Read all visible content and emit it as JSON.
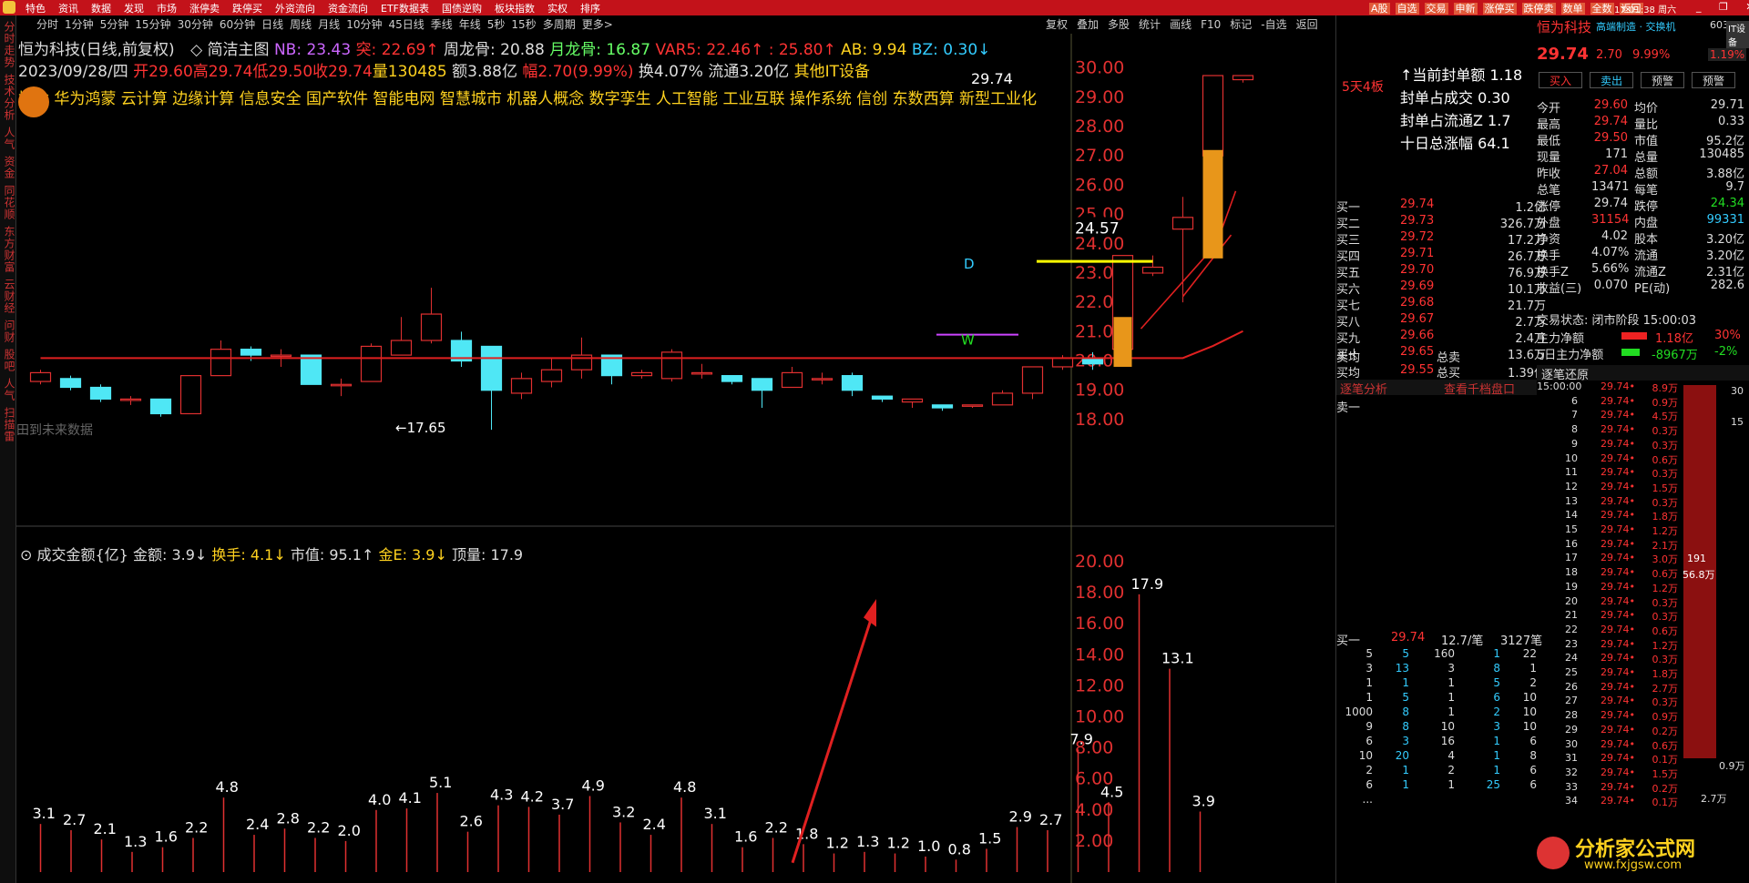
{
  "topbar": {
    "menu": [
      "特色",
      "资讯",
      "数据",
      "发现",
      "市场",
      "涨停卖",
      "跌停买",
      "外资流向",
      "资金流向",
      "ETF数据表",
      "国债逆购",
      "板块指数",
      "实权",
      "排序"
    ],
    "right": [
      "A股",
      "自选",
      "交易",
      "申新",
      "涨停买",
      "跌停卖",
      "数单",
      "全数",
      "返回"
    ],
    "clock": "17:01:38 周六",
    "winbtns": "_ ❐ ✕"
  },
  "periods": [
    "分时",
    "1分钟",
    "5分钟",
    "15分钟",
    "30分钟",
    "60分钟",
    "日线",
    "周线",
    "月线",
    "10分钟",
    "45日线",
    "季线",
    "年线",
    "5秒",
    "15秒",
    "多周期",
    "更多>"
  ],
  "rtools": [
    "复权",
    "叠加",
    "多股",
    "统计",
    "画线",
    "F10",
    "标记",
    "-自选",
    "返回"
  ],
  "leftstrip": [
    "分时走势",
    "技术分析",
    "人气",
    "资金",
    "同花顺",
    "东方财富",
    "云财经",
    "问财",
    "股吧",
    "人气",
    "扫描雷"
  ],
  "stock": {
    "name": "恒为科技(日线,前复权)",
    "indicator_main": "简洁主图",
    "nb": "NB: 23.43",
    "tu": "突: 22.69↑",
    "zhoulonggu": "周龙骨: 20.88",
    "yuelonggu": "月龙骨: 16.87",
    "var5": "VAR5: 22.46↑",
    "v2": ": 25.80↑",
    "ab": "AB: 9.94",
    "bz": "BZ: 0.30↓"
  },
  "quote_line": {
    "date": "2023/09/28/四",
    "open": "开29.60",
    "high": "高29.74",
    "low": "低29.50",
    "close": "收29.74",
    "vol": "量130485",
    "amt": "额3.88亿",
    "range": "幅2.70(9.99%)",
    "turn": "换4.07%",
    "float": "流通3.20亿",
    "industry": "其他IT设备"
  },
  "concepts": "概念 华为鸿蒙 云计算 边缘计算 信息安全 国产软件 智能电网 智慧城市 机器人概念 数字孪生 人工智能 工业互联 操作系统 信创 东数西算 新型工业化",
  "price_label": "29.74",
  "low_label": "17.65",
  "future_label": "田到未来数据",
  "marker_D": "D",
  "marker_W": "W",
  "cur_price_tag": "24.57",
  "vol_header": {
    "title": "成交金额{亿}",
    "je": "金额: 3.9↓",
    "hs": "换手: 4.1↓",
    "sz": "市值: 95.1↑",
    "jine": "金E: 3.9↓",
    "dl": "顶量: 17.9"
  },
  "price_axis": [
    "30.00",
    "29.00",
    "28.00",
    "27.00",
    "26.00",
    "25.00",
    "24.00",
    "23.00",
    "22.00",
    "21.00",
    "20.00",
    "19.00",
    "18.00"
  ],
  "vol_axis": [
    "20.00",
    "18.00",
    "16.00",
    "14.00",
    "12.00",
    "10.00",
    "8.00",
    "6.00",
    "4.00",
    "2.00"
  ],
  "chart_data": {
    "type": "candlestick+bar",
    "candles": [
      [
        19.3,
        19.6,
        19.2,
        19.7
      ],
      [
        19.4,
        19.1,
        19.0,
        19.5
      ],
      [
        19.1,
        18.7,
        18.6,
        19.2
      ],
      [
        18.7,
        18.7,
        18.5,
        18.8
      ],
      [
        18.7,
        18.2,
        18.1,
        18.7
      ],
      [
        18.2,
        19.5,
        18.2,
        19.5
      ],
      [
        19.5,
        20.4,
        19.5,
        20.7
      ],
      [
        20.4,
        20.2,
        20.0,
        20.5
      ],
      [
        20.2,
        20.2,
        19.8,
        20.4
      ],
      [
        20.2,
        19.2,
        19.2,
        20.2
      ],
      [
        19.2,
        19.2,
        18.8,
        19.4
      ],
      [
        19.3,
        20.5,
        19.3,
        20.6
      ],
      [
        20.2,
        20.7,
        20.2,
        21.5
      ],
      [
        20.7,
        21.6,
        20.6,
        22.5
      ],
      [
        20.7,
        20.0,
        19.8,
        21.0
      ],
      [
        20.5,
        19.0,
        17.65,
        20.5
      ],
      [
        18.9,
        19.4,
        18.7,
        19.6
      ],
      [
        19.3,
        19.7,
        19.1,
        20.1
      ],
      [
        19.7,
        20.2,
        19.4,
        20.8
      ],
      [
        20.2,
        19.5,
        19.2,
        20.2
      ],
      [
        19.5,
        19.6,
        19.4,
        19.7
      ],
      [
        19.4,
        20.3,
        19.3,
        20.4
      ],
      [
        19.6,
        19.6,
        19.4,
        19.9
      ],
      [
        19.5,
        19.3,
        19.2,
        19.4
      ],
      [
        19.4,
        19.0,
        18.4,
        19.4
      ],
      [
        19.1,
        19.6,
        19.1,
        19.8
      ],
      [
        19.4,
        19.4,
        19.2,
        19.6
      ],
      [
        19.5,
        19.0,
        18.8,
        19.6
      ],
      [
        18.8,
        18.7,
        18.6,
        18.8
      ],
      [
        18.6,
        18.7,
        18.4,
        18.7
      ],
      [
        18.5,
        18.4,
        18.3,
        18.5
      ],
      [
        18.5,
        18.5,
        18.4,
        18.5
      ],
      [
        18.5,
        18.9,
        18.5,
        19.0
      ],
      [
        18.9,
        19.8,
        18.7,
        19.8
      ],
      [
        19.8,
        20.1,
        19.7,
        20.2
      ],
      [
        20.1,
        19.9,
        19.7,
        20.3
      ],
      [
        20.4,
        23.6,
        20.4,
        23.6
      ],
      [
        23.0,
        23.2,
        22.9,
        23.6
      ],
      [
        24.5,
        24.9,
        22.0,
        25.6
      ],
      [
        27.0,
        29.74,
        24.8,
        29.74
      ],
      [
        29.6,
        29.74,
        29.5,
        29.74
      ]
    ],
    "volumes": [
      3.1,
      2.7,
      2.1,
      1.3,
      1.6,
      2.2,
      4.8,
      2.4,
      2.8,
      2.2,
      2.0,
      4.0,
      4.1,
      5.1,
      2.6,
      4.3,
      4.2,
      3.7,
      4.9,
      3.2,
      2.4,
      4.8,
      3.1,
      1.6,
      2.2,
      1.8,
      1.2,
      1.3,
      1.2,
      1.0,
      0.8,
      1.5,
      2.9,
      2.7,
      7.9,
      4.5,
      17.9,
      13.1,
      3.9
    ],
    "ylim": [
      17.5,
      30.3
    ],
    "vol_ylim": [
      0,
      21
    ]
  },
  "right": {
    "title": "恒为科技",
    "sub": "高端制造 · 交换机",
    "code": "603",
    "tag": "IT设备",
    "price": "29.74",
    "chg": "2.70",
    "pct": "9.99%",
    "pct2": "1.19%",
    "btns": [
      "买入",
      "卖出",
      "预警",
      "预警"
    ],
    "stats": [
      [
        "今开",
        "29.60",
        "均价",
        "29.71"
      ],
      [
        "最高",
        "29.74",
        "量比",
        "0.33"
      ],
      [
        "最低",
        "29.50",
        "市值",
        "95.2亿"
      ],
      [
        "现量",
        "171",
        "总量",
        "130485"
      ],
      [
        "昨收",
        "27.04",
        "总额",
        "3.88亿"
      ],
      [
        "总笔",
        "13471",
        "每笔",
        "9.7"
      ],
      [
        "涨停",
        "29.74",
        "跌停",
        "24.34"
      ],
      [
        "外盘",
        "31154",
        "内盘",
        "99331"
      ],
      [
        "净资",
        "4.02",
        "股本",
        "3.20亿"
      ],
      [
        "换手",
        "4.07%",
        "流通",
        "3.20亿"
      ],
      [
        "换手Z",
        "5.66%",
        "流通Z",
        "2.31亿"
      ],
      [
        "收益(三)",
        "0.070",
        "PE(动)",
        "282.6"
      ]
    ],
    "status": "交易状态: 闭市阶段 15:00:03",
    "zl": [
      "主力净额",
      "1.18亿",
      "30%"
    ],
    "zl5": [
      "5日主力净额",
      "-8967万",
      "-2%"
    ],
    "seal_lines": [
      "↑当前封单额 1.18",
      "封单占成交 0.30",
      "封单占流通Z 1.7",
      "十日总涨幅 64.1"
    ],
    "streak": "5天4板",
    "bids": [
      [
        "买一",
        "29.74",
        "1.2亿"
      ],
      [
        "买二",
        "29.73",
        "326.7万"
      ],
      [
        "买三",
        "29.72",
        "17.2万"
      ],
      [
        "买四",
        "29.71",
        "26.7万"
      ],
      [
        "买五",
        "29.70",
        "76.9万"
      ],
      [
        "买六",
        "29.69",
        "10.1万"
      ],
      [
        "买七",
        "29.68",
        "21.7万"
      ],
      [
        "买八",
        "29.67",
        "2.7万"
      ],
      [
        "买九",
        "29.66",
        "2.4万"
      ],
      [
        "买十",
        "29.65",
        "13.6万"
      ]
    ],
    "mai": [
      "卖均",
      "",
      "总卖",
      "",
      "买均",
      "29.55",
      "总买",
      "1.39亿"
    ],
    "analysis": [
      "逐笔分析",
      "查看千档盘口"
    ],
    "sell1": "卖一",
    "buy1": [
      "买一",
      "29.74",
      "12.7/笔",
      "3127笔"
    ],
    "queue": [
      [
        "5",
        "5",
        "160",
        "1",
        "22"
      ],
      [
        "3",
        "13",
        "3",
        "8",
        "1"
      ],
      [
        "1",
        "1",
        "1",
        "5",
        "2"
      ],
      [
        "1",
        "5",
        "1",
        "6",
        "10"
      ],
      [
        "1000",
        "8",
        "1",
        "2",
        "10"
      ],
      [
        "9",
        "8",
        "10",
        "3",
        "10"
      ],
      [
        "6",
        "3",
        "16",
        "1",
        "6"
      ],
      [
        "10",
        "20",
        "4",
        "1",
        "8"
      ],
      [
        "2",
        "1",
        "2",
        "1",
        "6"
      ],
      [
        "6",
        "1",
        "1",
        "25",
        "6"
      ],
      [
        "...",
        "",
        "",
        "",
        ""
      ]
    ],
    "tick_title": "逐笔还原",
    "ticks": [
      [
        "15:00:00",
        "29.74",
        "8.9万"
      ],
      [
        "6",
        "29.74",
        "0.9万"
      ],
      [
        "7",
        "29.74",
        "4.5万"
      ],
      [
        "8",
        "29.74",
        "0.3万"
      ],
      [
        "9",
        "29.74",
        "0.3万"
      ],
      [
        "10",
        "29.74",
        "0.6万"
      ],
      [
        "11",
        "29.74",
        "0.3万"
      ],
      [
        "12",
        "29.74",
        "1.5万"
      ],
      [
        "13",
        "29.74",
        "0.3万"
      ],
      [
        "14",
        "29.74",
        "1.8万"
      ],
      [
        "15",
        "29.74",
        "1.2万"
      ],
      [
        "16",
        "29.74",
        "2.1万"
      ],
      [
        "17",
        "29.74",
        "3.0万"
      ],
      [
        "18",
        "29.74",
        "0.6万"
      ],
      [
        "19",
        "29.74",
        "1.2万"
      ],
      [
        "20",
        "29.74",
        "0.3万"
      ],
      [
        "21",
        "29.74",
        "0.3万"
      ],
      [
        "22",
        "29.74",
        "0.6万"
      ],
      [
        "23",
        "29.74",
        "1.2万"
      ],
      [
        "24",
        "29.74",
        "0.3万"
      ],
      [
        "25",
        "29.74",
        "1.8万"
      ],
      [
        "26",
        "29.74",
        "2.7万"
      ],
      [
        "27",
        "29.74",
        "0.3万"
      ],
      [
        "28",
        "29.74",
        "0.9万"
      ],
      [
        "29",
        "29.74",
        "0.2万"
      ],
      [
        "30",
        "29.74",
        "0.6万"
      ],
      [
        "31",
        "29.74",
        "0.1万"
      ],
      [
        "32",
        "29.74",
        "1.5万"
      ],
      [
        "33",
        "29.74",
        "0.2万"
      ],
      [
        "34",
        "29.74",
        "0.1万"
      ]
    ],
    "tick_bar": [
      "191",
      "56.8万"
    ],
    "tick_side": [
      "30",
      "15",
      "2.7万",
      "0.9万"
    ],
    "watermark": "分析家公式网",
    "watermark_url": "www.fxjgsw.com"
  }
}
